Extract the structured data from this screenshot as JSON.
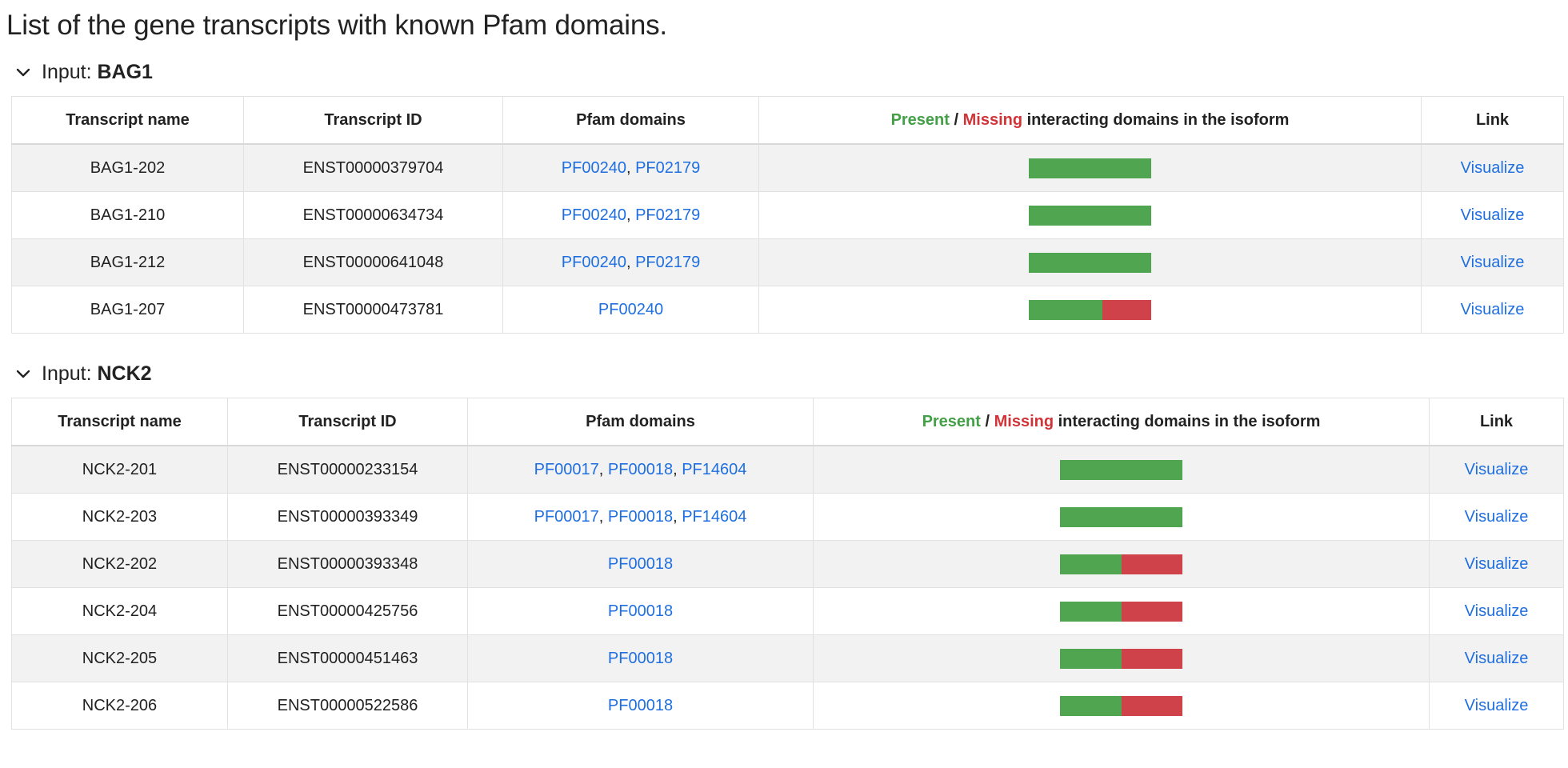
{
  "page": {
    "title": "List of the gene transcripts with known Pfam domains."
  },
  "colors": {
    "present": "#50a650",
    "missing": "#d0424a",
    "link": "#1f6fe0"
  },
  "icons": {
    "collapse": "chevron-down-icon"
  },
  "columns": {
    "transcript_name": "Transcript name",
    "transcript_id": "Transcript ID",
    "pfam_domains": "Pfam domains",
    "present_label": "Present",
    "separator": " / ",
    "missing_label": "Missing",
    "domains_suffix": " interacting domains in the isoform",
    "link": "Link"
  },
  "sections": [
    {
      "label_prefix": "Input: ",
      "gene": "BAG1",
      "rows": [
        {
          "name": "BAG1-202",
          "id": "ENST00000379704",
          "pfam": [
            "PF00240",
            "PF02179"
          ],
          "present_fraction": 1.0,
          "link": "Visualize"
        },
        {
          "name": "BAG1-210",
          "id": "ENST00000634734",
          "pfam": [
            "PF00240",
            "PF02179"
          ],
          "present_fraction": 1.0,
          "link": "Visualize"
        },
        {
          "name": "BAG1-212",
          "id": "ENST00000641048",
          "pfam": [
            "PF00240",
            "PF02179"
          ],
          "present_fraction": 1.0,
          "link": "Visualize"
        },
        {
          "name": "BAG1-207",
          "id": "ENST00000473781",
          "pfam": [
            "PF00240"
          ],
          "present_fraction": 0.6,
          "link": "Visualize"
        }
      ]
    },
    {
      "label_prefix": "Input: ",
      "gene": "NCK2",
      "rows": [
        {
          "name": "NCK2-201",
          "id": "ENST00000233154",
          "pfam": [
            "PF00017",
            "PF00018",
            "PF14604"
          ],
          "present_fraction": 1.0,
          "link": "Visualize"
        },
        {
          "name": "NCK2-203",
          "id": "ENST00000393349",
          "pfam": [
            "PF00017",
            "PF00018",
            "PF14604"
          ],
          "present_fraction": 1.0,
          "link": "Visualize"
        },
        {
          "name": "NCK2-202",
          "id": "ENST00000393348",
          "pfam": [
            "PF00018"
          ],
          "present_fraction": 0.5,
          "link": "Visualize"
        },
        {
          "name": "NCK2-204",
          "id": "ENST00000425756",
          "pfam": [
            "PF00018"
          ],
          "present_fraction": 0.5,
          "link": "Visualize"
        },
        {
          "name": "NCK2-205",
          "id": "ENST00000451463",
          "pfam": [
            "PF00018"
          ],
          "present_fraction": 0.5,
          "link": "Visualize"
        },
        {
          "name": "NCK2-206",
          "id": "ENST00000522586",
          "pfam": [
            "PF00018"
          ],
          "present_fraction": 0.5,
          "link": "Visualize"
        }
      ]
    }
  ]
}
